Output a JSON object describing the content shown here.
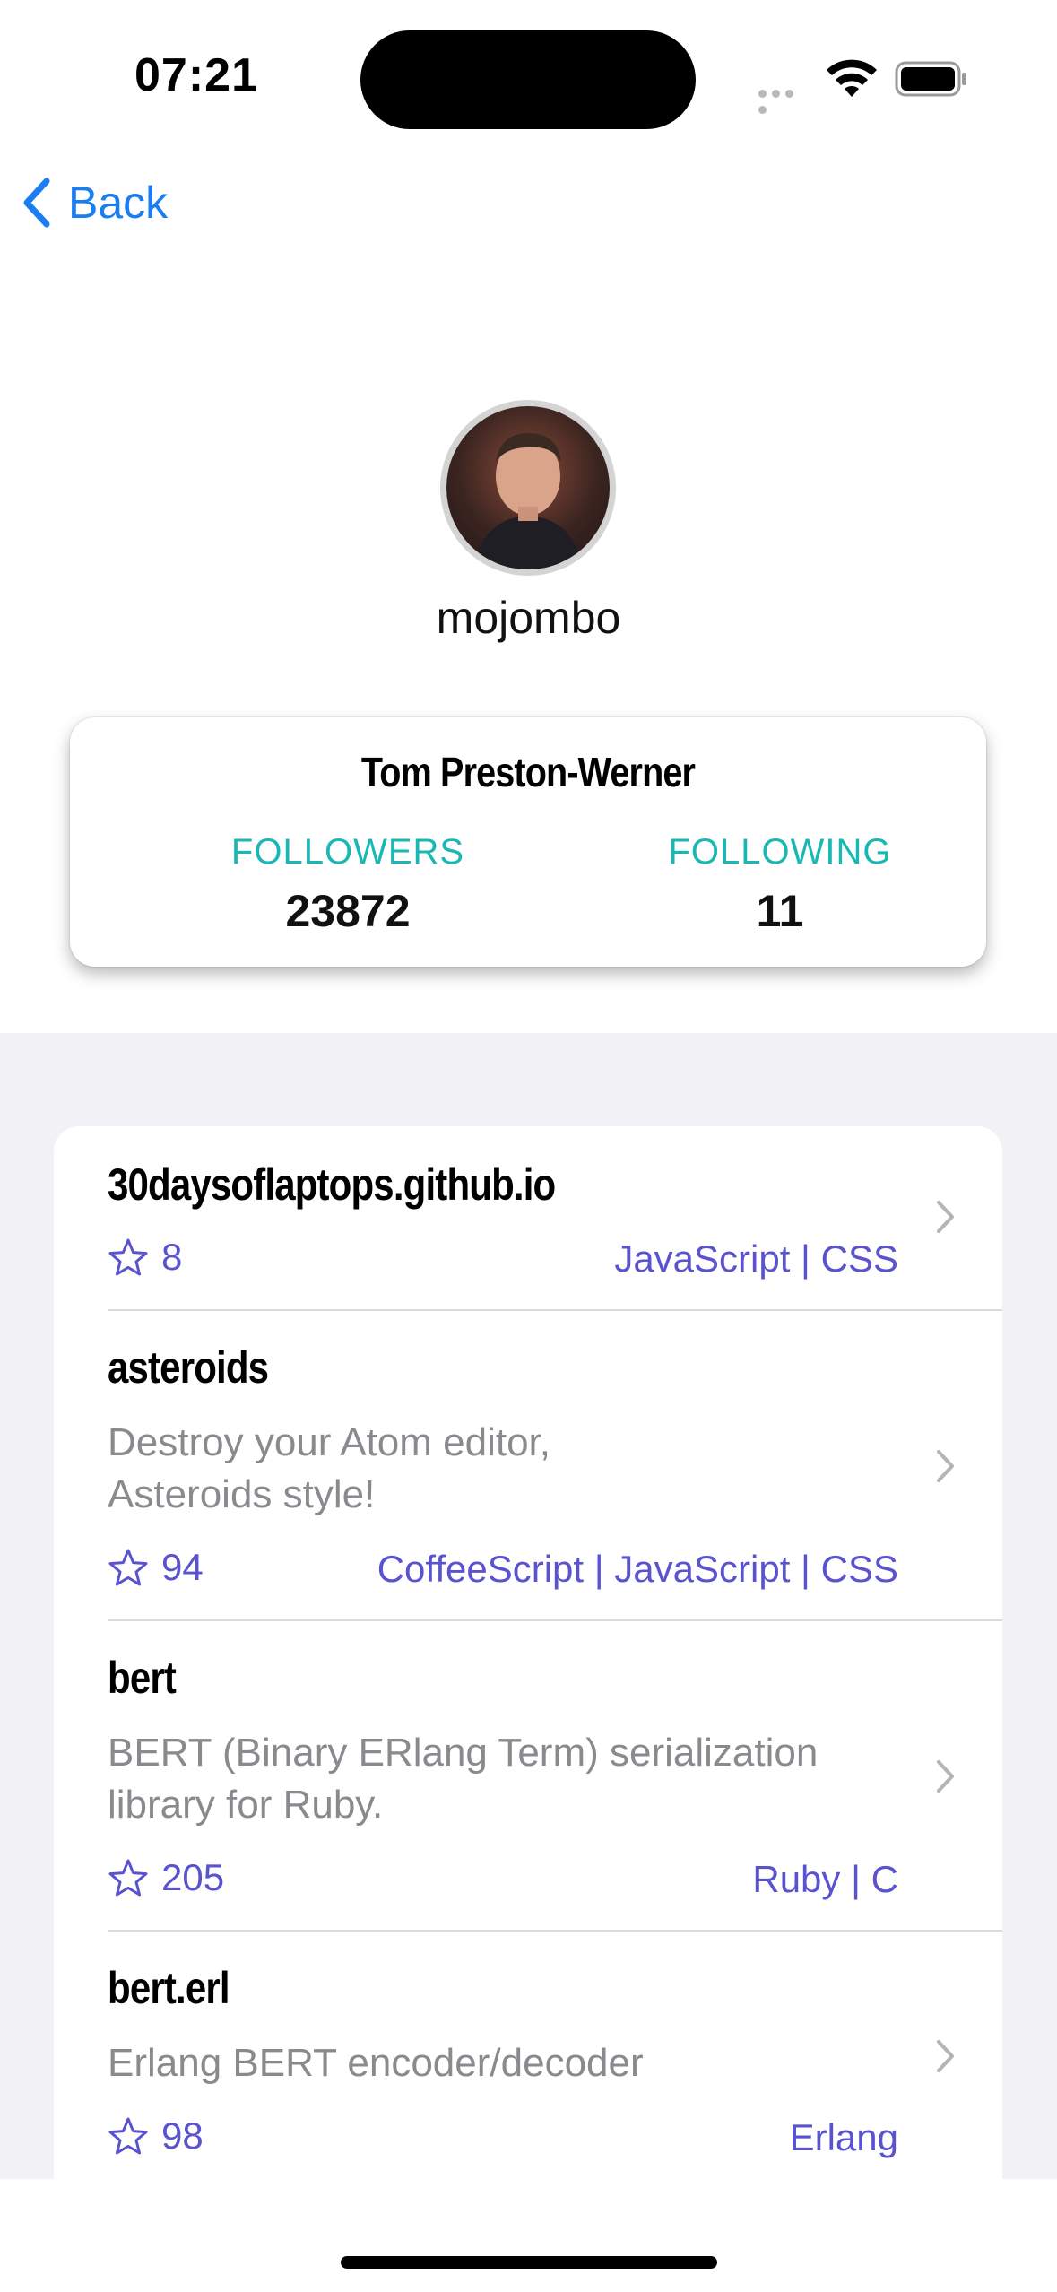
{
  "status": {
    "time": "07:21"
  },
  "nav": {
    "back_label": "Back"
  },
  "profile": {
    "username": "mojombo",
    "full_name": "Tom Preston-Werner",
    "followers_label": "FOLLOWERS",
    "followers_count": "23872",
    "following_label": "FOLLOWING",
    "following_count": "11"
  },
  "repos": [
    {
      "name": "30daysoflaptops.github.io",
      "description": "",
      "stars": "8",
      "languages": "JavaScript | CSS"
    },
    {
      "name": "asteroids",
      "description": "Destroy your Atom editor, Asteroids style!",
      "stars": "94",
      "languages": "CoffeeScript | JavaScript | CSS"
    },
    {
      "name": "bert",
      "description": "BERT (Binary ERlang Term) serialization library for Ruby.",
      "stars": "205",
      "languages": "Ruby | C"
    },
    {
      "name": "bert.erl",
      "description": "Erlang BERT encoder/decoder",
      "stars": "98",
      "languages": "Erlang"
    }
  ],
  "colors": {
    "accent_blue": "#1a7df2",
    "teal": "#1ab8b5",
    "purple": "#5a53cf",
    "list_bg": "#f1f1f6"
  },
  "icons": {
    "back": "chevron-left-icon",
    "star": "star-outline-icon",
    "disclosure": "chevron-right-icon"
  }
}
